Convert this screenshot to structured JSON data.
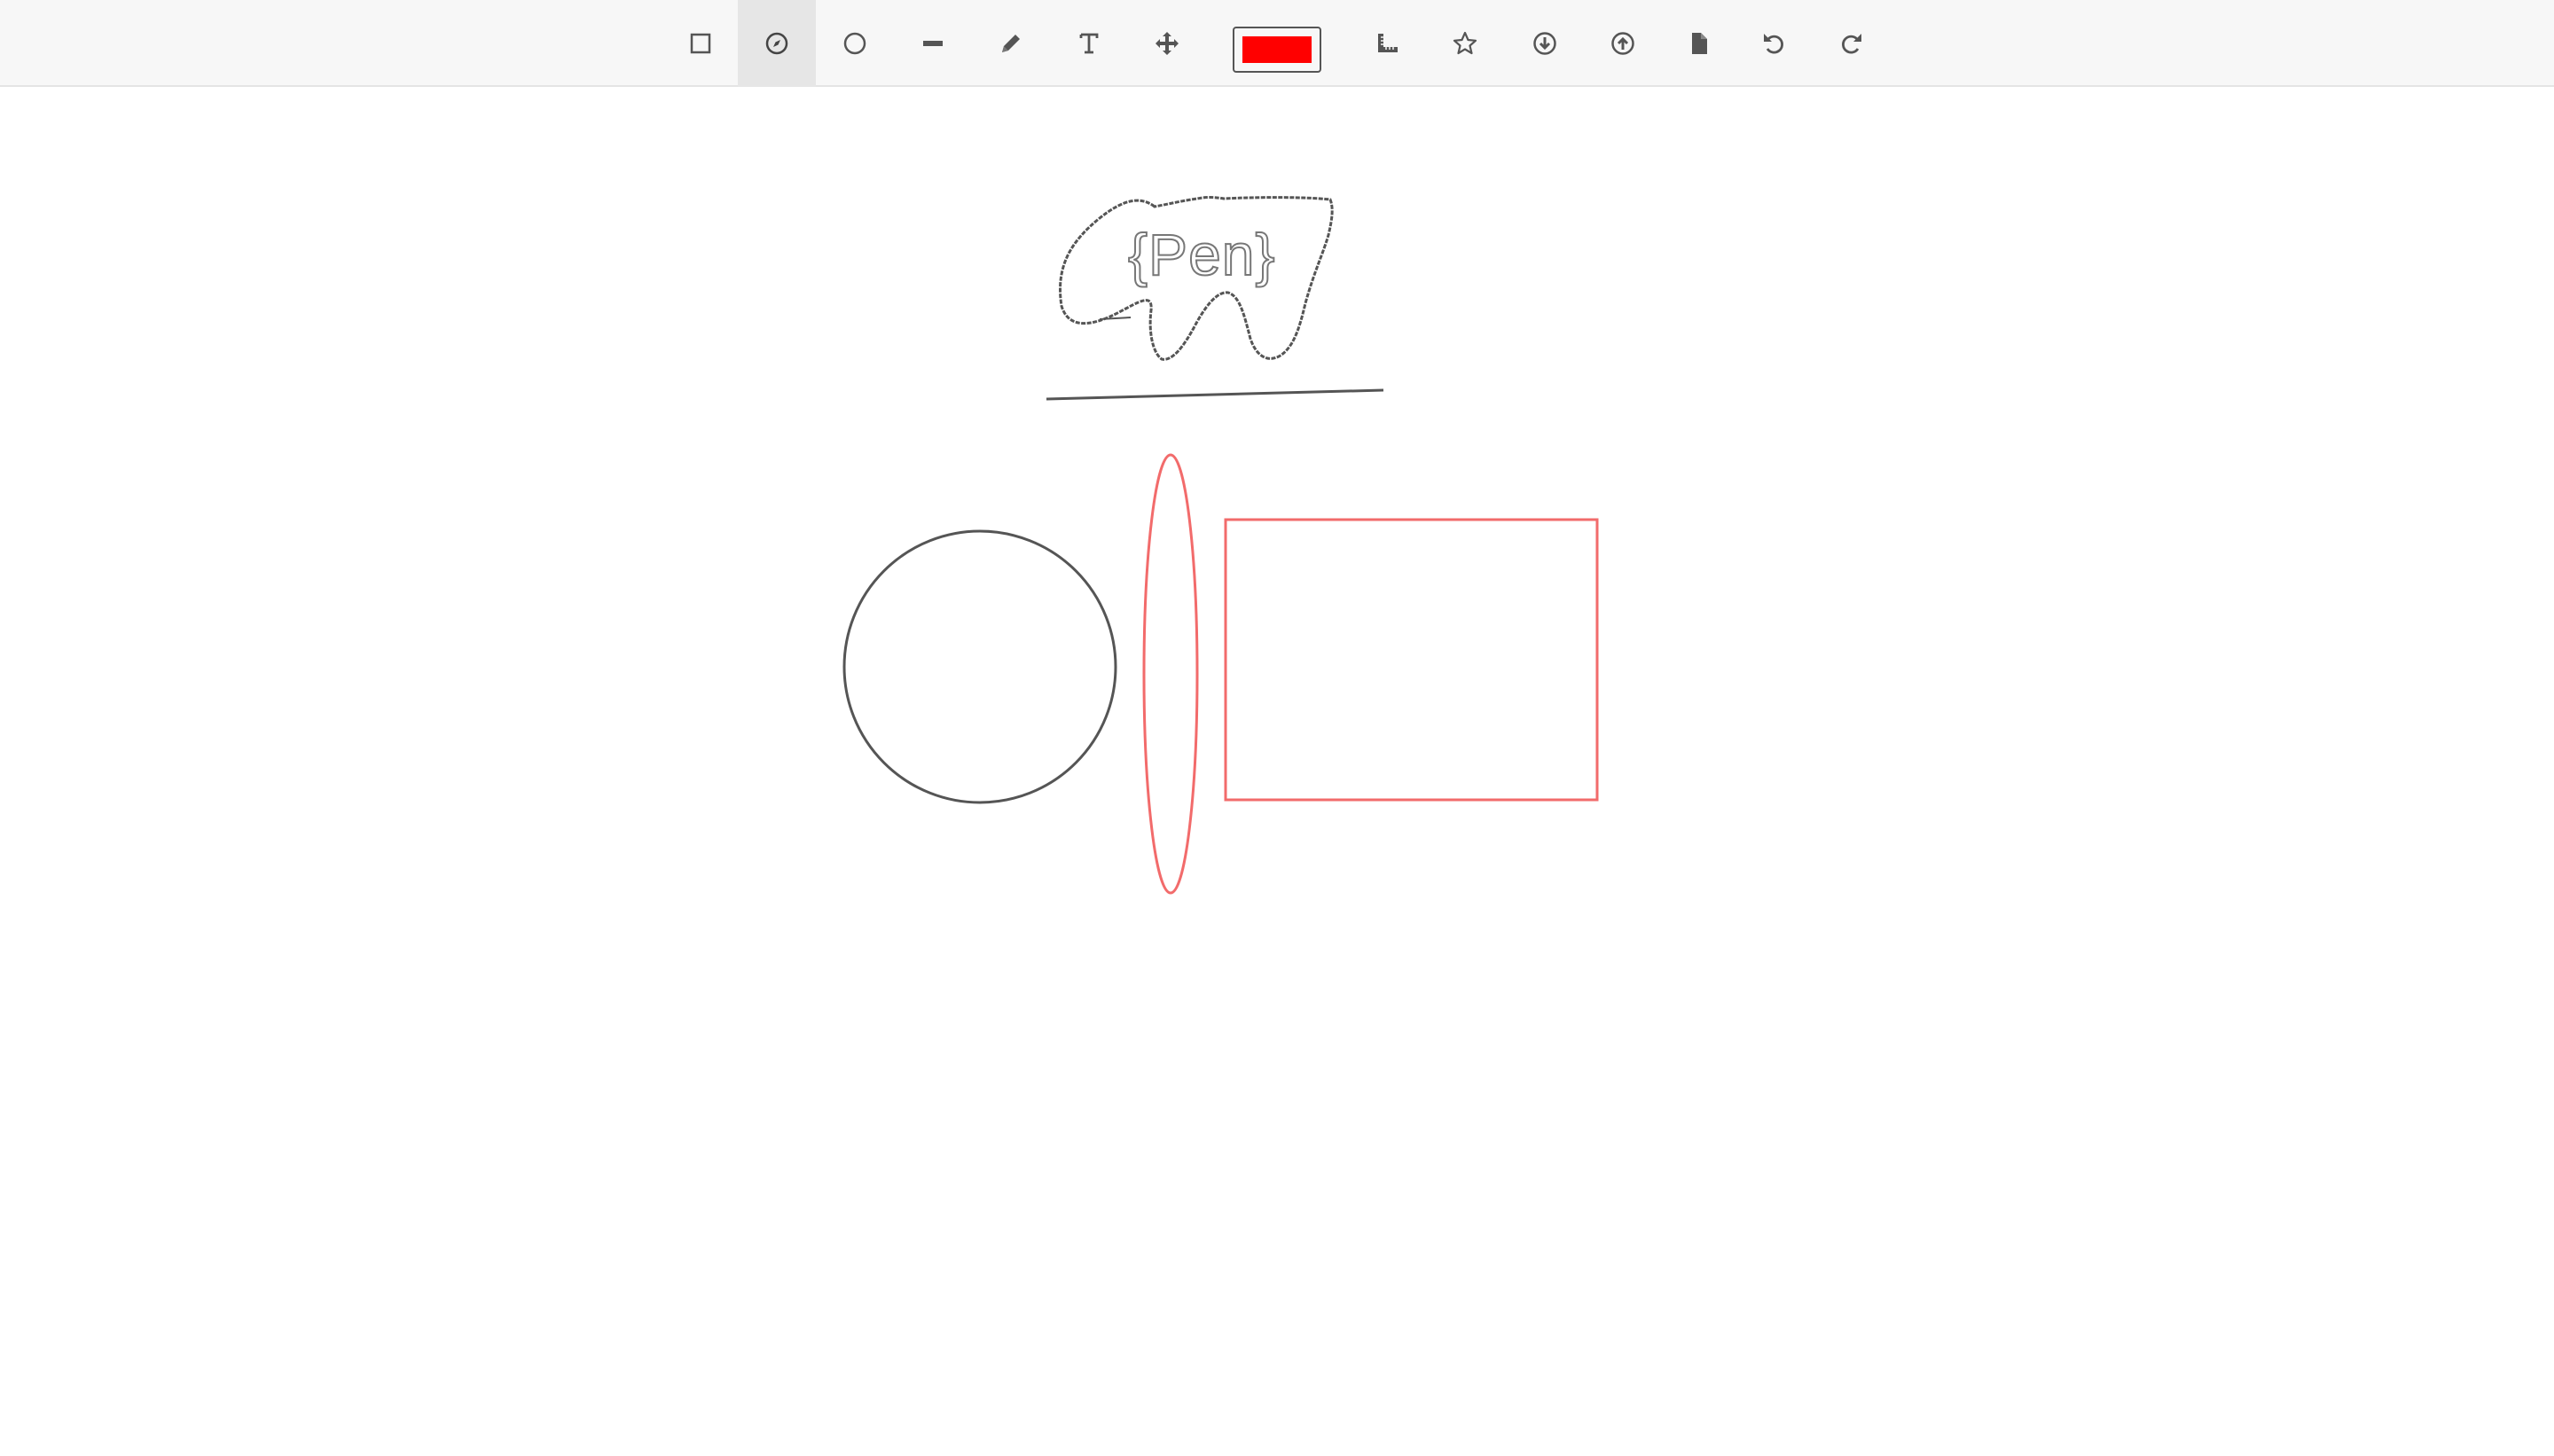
{
  "toolbar": {
    "tools": [
      {
        "name": "rectangle-tool",
        "icon": "square-icon",
        "active": false
      },
      {
        "name": "compass-tool",
        "icon": "compass-icon",
        "active": true
      },
      {
        "name": "circle-tool",
        "icon": "circle-icon",
        "active": false
      },
      {
        "name": "line-tool",
        "icon": "minus-icon",
        "active": false
      },
      {
        "name": "pencil-tool",
        "icon": "pencil-icon",
        "active": false
      },
      {
        "name": "text-tool",
        "icon": "text-cursor-icon",
        "active": false
      },
      {
        "name": "move-tool",
        "icon": "move-arrows-icon",
        "active": false
      },
      {
        "name": "ruler-tool",
        "icon": "ruler-icon",
        "active": false
      },
      {
        "name": "star-tool",
        "icon": "star-icon",
        "active": false
      },
      {
        "name": "download-button",
        "icon": "download-circle-icon",
        "active": false
      },
      {
        "name": "upload-button",
        "icon": "upload-circle-icon",
        "active": false
      },
      {
        "name": "new-document-button",
        "icon": "file-icon",
        "active": false
      },
      {
        "name": "undo-button",
        "icon": "undo-icon",
        "active": false
      },
      {
        "name": "redo-button",
        "icon": "redo-icon",
        "active": false
      }
    ],
    "current_color": "#ff0000"
  },
  "canvas": {
    "logo_text": "{Pen}",
    "stroke_colors": {
      "dark": "#555555",
      "red": "#f26b6b"
    }
  }
}
